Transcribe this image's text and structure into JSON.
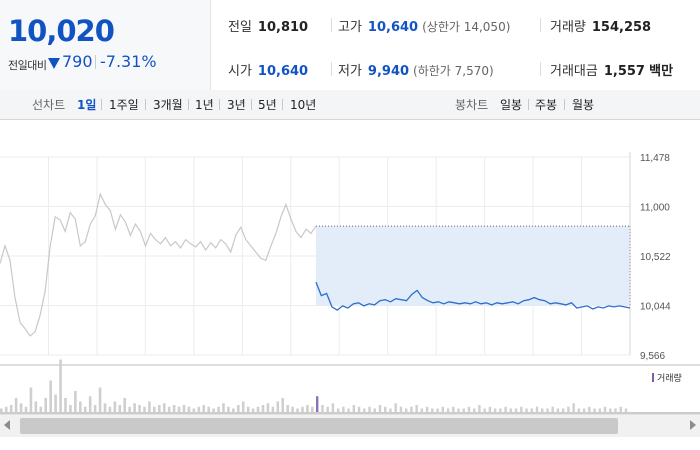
{
  "summary": {
    "current_price": "10,020",
    "change_label": "전일대비",
    "change_direction": "down",
    "change_amount": "790",
    "change_percent": "-7.31%",
    "stats": {
      "prev_close": {
        "label": "전일",
        "value": "10,810"
      },
      "high": {
        "label": "고가",
        "value": "10,640",
        "note": "(상한가 14,050)"
      },
      "volume": {
        "label": "거래량",
        "value": "154,258"
      },
      "open": {
        "label": "시가",
        "value": "10,640"
      },
      "low": {
        "label": "저가",
        "value": "9,940",
        "note": "(하한가 7,570)"
      },
      "trade_value": {
        "label": "거래대금",
        "value": "1,557",
        "unit": "백만"
      }
    }
  },
  "tabs": {
    "line_label": "선차트",
    "periods": [
      "1일",
      "1주일",
      "3개월",
      "1년",
      "3년",
      "5년",
      "10년"
    ],
    "active_period": "1일",
    "candle_label": "봉차트",
    "candles": [
      "일봉",
      "주봉",
      "월봉"
    ]
  },
  "colors": {
    "down_blue": "#1253c4",
    "line_prev": "#c8c8c8",
    "line_today": "#2c6fcf",
    "fill_range": "#e3ecf9",
    "volume_bar": "#cfcfcf"
  },
  "chart_data": {
    "type": "line",
    "y_ticks": [
      "11,478",
      "11,000",
      "10,522",
      "10,044",
      "9,566"
    ],
    "ylim": [
      9566,
      11478
    ],
    "grid": true,
    "series": [
      {
        "role": "previous-day",
        "y": [
          10450,
          10620,
          10480,
          10120,
          9880,
          9820,
          9750,
          9790,
          9950,
          10180,
          10620,
          10900,
          10870,
          10760,
          10940,
          10880,
          10620,
          10660,
          10830,
          10910,
          11120,
          11020,
          10960,
          10780,
          10920,
          10850,
          10720,
          10830,
          10760,
          10620,
          10740,
          10680,
          10640,
          10700,
          10620,
          10660,
          10600,
          10680,
          10640,
          10610,
          10660,
          10580,
          10650,
          10600,
          10680,
          10640,
          10560,
          10720,
          10800,
          10680,
          10620,
          10560,
          10500,
          10480,
          10620,
          10740,
          10900,
          11020,
          10880,
          10760,
          10700,
          10780,
          10740,
          10810
        ]
      },
      {
        "role": "today",
        "y": [
          10270,
          10140,
          10160,
          10030,
          10000,
          10040,
          10020,
          10060,
          10070,
          10040,
          10060,
          10050,
          10090,
          10100,
          10080,
          10110,
          10100,
          10090,
          10150,
          10190,
          10120,
          10090,
          10070,
          10080,
          10060,
          10080,
          10070,
          10060,
          10070,
          10060,
          10080,
          10060,
          10070,
          10050,
          10070,
          10060,
          10070,
          10080,
          10060,
          10090,
          10100,
          10120,
          10100,
          10090,
          10060,
          10070,
          10060,
          10050,
          10070,
          10020,
          10030,
          10040,
          10010,
          10030,
          10020,
          10040,
          10030,
          10040,
          10030,
          10020
        ]
      }
    ],
    "reference_line": 10810,
    "range_box": {
      "from": 10810,
      "to": 10044
    },
    "volume_legend": "거래량",
    "volume_prev": [
      2,
      3,
      4,
      8,
      5,
      3,
      14,
      6,
      3,
      8,
      18,
      10,
      30,
      8,
      4,
      12,
      6,
      3,
      9,
      4,
      14,
      5,
      3,
      6,
      4,
      8,
      3,
      5,
      4,
      3,
      6,
      3,
      4,
      5,
      3,
      4,
      3,
      4,
      3,
      2,
      3,
      4,
      3,
      2,
      3,
      5,
      3,
      2,
      4,
      6,
      3,
      2,
      3,
      4,
      5,
      3,
      6,
      8,
      4,
      3,
      2,
      3,
      4,
      3
    ],
    "volume_today": [
      9,
      4,
      3,
      5,
      2,
      3,
      2,
      4,
      3,
      2,
      3,
      2,
      4,
      3,
      2,
      5,
      3,
      2,
      3,
      4,
      2,
      3,
      2,
      2,
      3,
      2,
      3,
      2,
      2,
      3,
      2,
      4,
      2,
      3,
      2,
      2,
      3,
      2,
      2,
      3,
      2,
      2,
      3,
      2,
      2,
      3,
      2,
      2,
      3,
      5,
      2,
      2,
      3,
      2,
      2,
      3,
      2,
      2,
      3,
      2
    ]
  }
}
